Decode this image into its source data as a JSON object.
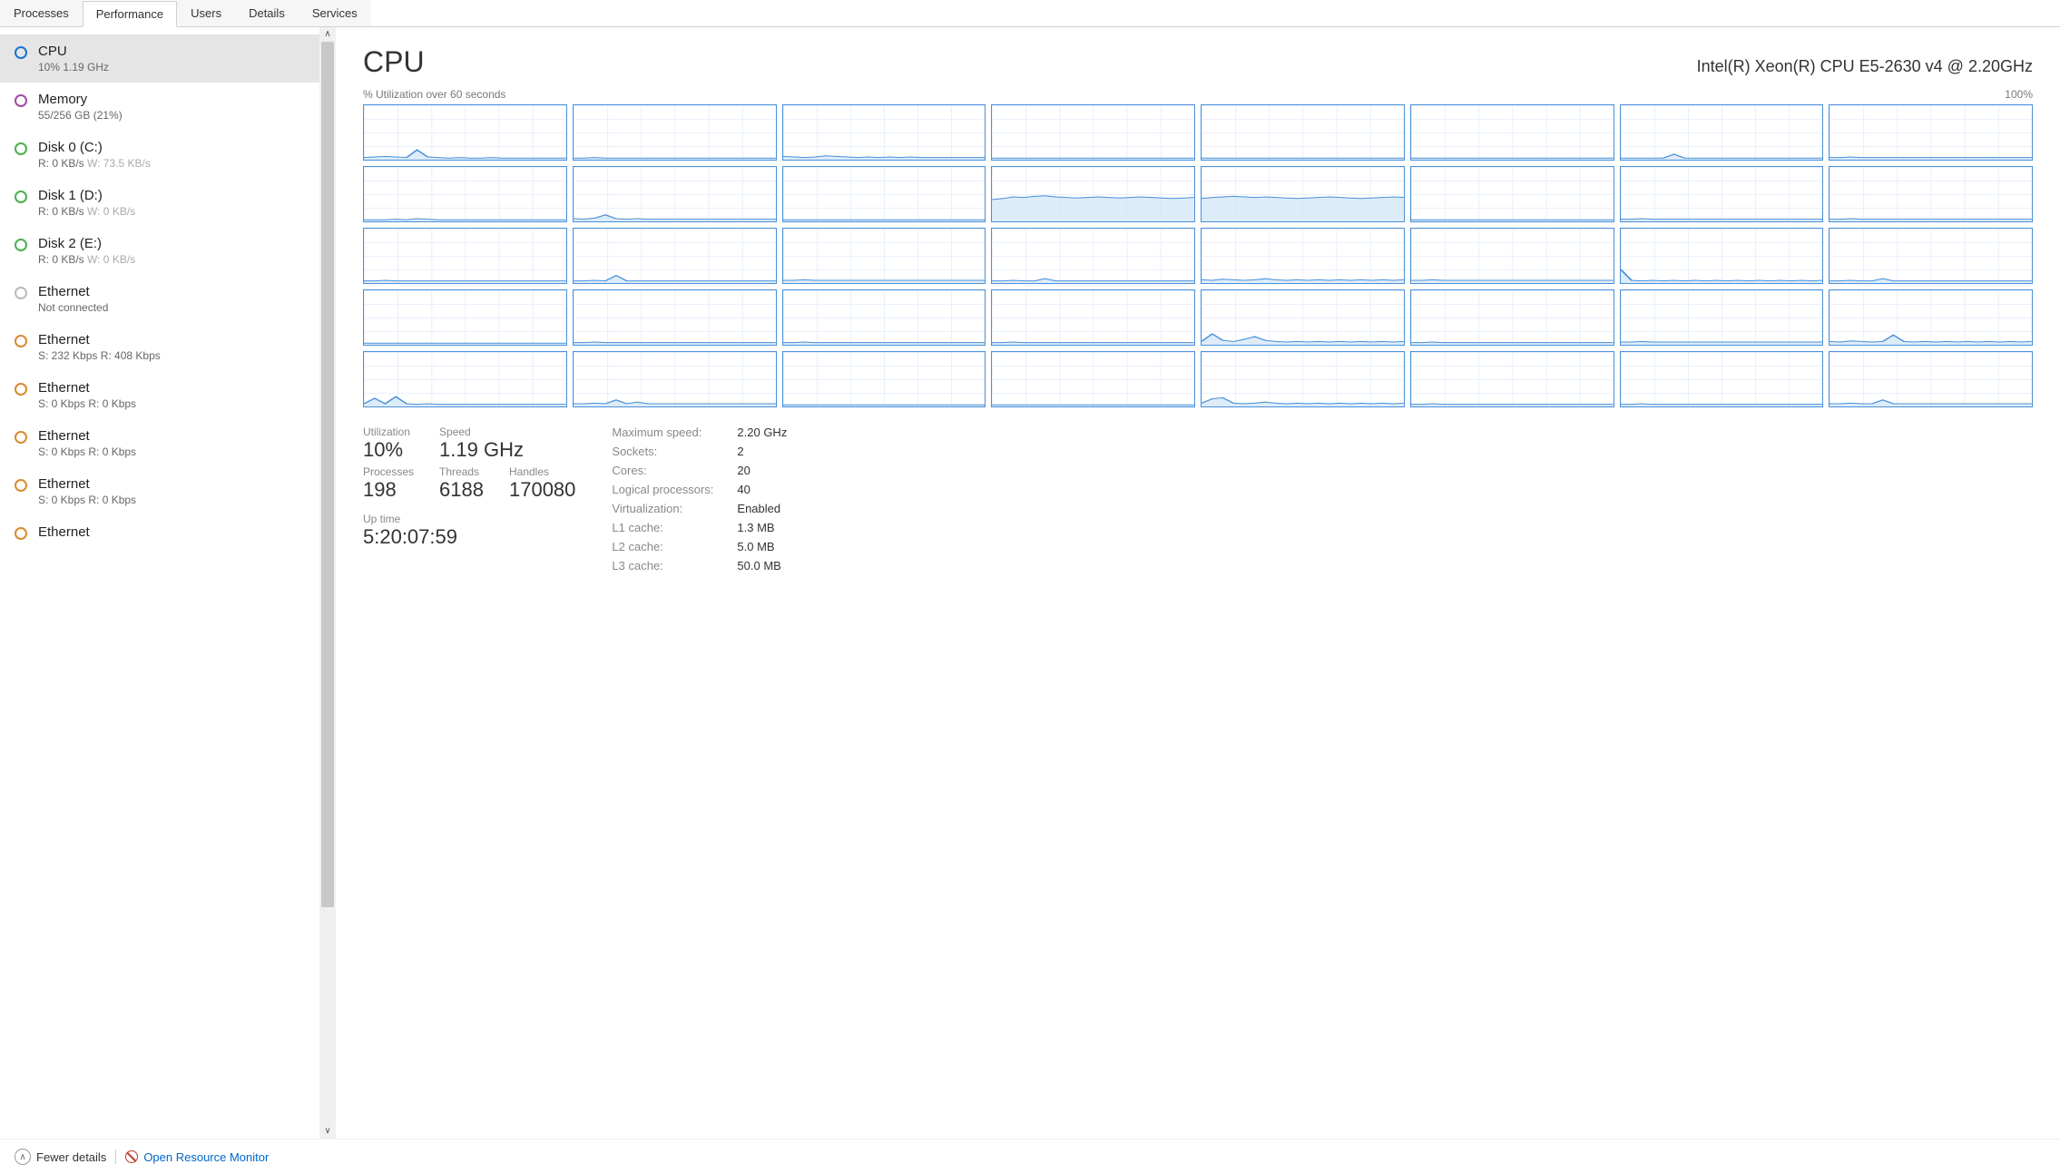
{
  "tabs": [
    "Processes",
    "Performance",
    "Users",
    "Details",
    "Services"
  ],
  "active_tab": 1,
  "sidebar": [
    {
      "title": "CPU",
      "sub": "10% 1.19 GHz",
      "color": "blue",
      "selected": true
    },
    {
      "title": "Memory",
      "sub": "55/256 GB (21%)",
      "color": "purple"
    },
    {
      "title": "Disk 0 (C:)",
      "sub": "R: 0 KB/s <span class='dim'>W: 73.5 KB/s</span>",
      "color": "green"
    },
    {
      "title": "Disk 1 (D:)",
      "sub": "R: 0 KB/s <span class='dim'>W: 0 KB/s</span>",
      "color": "green"
    },
    {
      "title": "Disk 2 (E:)",
      "sub": "R: 0 KB/s <span class='dim'>W: 0 KB/s</span>",
      "color": "green"
    },
    {
      "title": "Ethernet",
      "sub": "Not connected",
      "color": "gray"
    },
    {
      "title": "Ethernet",
      "sub": "S: 232 Kbps R: 408 Kbps",
      "color": "orange"
    },
    {
      "title": "Ethernet",
      "sub": "S: 0 Kbps R: 0 Kbps",
      "color": "orange"
    },
    {
      "title": "Ethernet",
      "sub": "S: 0 Kbps R: 0 Kbps",
      "color": "orange"
    },
    {
      "title": "Ethernet",
      "sub": "S: 0 Kbps R: 0 Kbps",
      "color": "orange"
    },
    {
      "title": "Ethernet",
      "sub": "",
      "color": "orange"
    }
  ],
  "header": {
    "title": "CPU",
    "subtitle": "Intel(R) Xeon(R) CPU E5-2630 v4 @ 2.20GHz"
  },
  "graph_label_left": "% Utilization over 60 seconds",
  "graph_label_right": "100%",
  "big_stats": {
    "utilization_label": "Utilization",
    "utilization": "10%",
    "speed_label": "Speed",
    "speed": "1.19 GHz",
    "processes_label": "Processes",
    "processes": "198",
    "threads_label": "Threads",
    "threads": "6188",
    "handles_label": "Handles",
    "handles": "170080",
    "uptime_label": "Up time",
    "uptime": "5:20:07:59"
  },
  "specs": [
    {
      "label": "Maximum speed:",
      "value": "2.20 GHz"
    },
    {
      "label": "Sockets:",
      "value": "2"
    },
    {
      "label": "Cores:",
      "value": "20"
    },
    {
      "label": "Logical processors:",
      "value": "40"
    },
    {
      "label": "Virtualization:",
      "value": "Enabled"
    },
    {
      "label": "L1 cache:",
      "value": "1.3 MB"
    },
    {
      "label": "L2 cache:",
      "value": "5.0 MB"
    },
    {
      "label": "L3 cache:",
      "value": "50.0 MB"
    }
  ],
  "footer": {
    "fewer": "Fewer details",
    "monitor": "Open Resource Monitor"
  },
  "chart_data": {
    "type": "area",
    "title": "% Utilization over 60 seconds",
    "xlabel": "seconds",
    "ylabel": "% utilization",
    "xlim": [
      0,
      60
    ],
    "ylim": [
      0,
      100
    ],
    "note": "40 small-multiple sparklines (one per logical processor). Values are approximate utilization samples read from the grid; most cores idle near 3–10%, a few (row2 col4–5) sustained ~45%, occasional spikes to 15–25%.",
    "series": [
      {
        "core": 0,
        "values": [
          4,
          5,
          6,
          5,
          4,
          18,
          5,
          4,
          3,
          4,
          3,
          3,
          4,
          3,
          3,
          3,
          3,
          3,
          3,
          3
        ]
      },
      {
        "core": 1,
        "values": [
          3,
          3,
          4,
          3,
          3,
          3,
          3,
          3,
          3,
          3,
          3,
          3,
          3,
          3,
          3,
          3,
          3,
          3,
          3,
          3
        ]
      },
      {
        "core": 2,
        "values": [
          6,
          5,
          4,
          5,
          7,
          6,
          5,
          4,
          5,
          4,
          5,
          4,
          5,
          4,
          4,
          4,
          4,
          4,
          4,
          4
        ]
      },
      {
        "core": 3,
        "values": [
          3,
          3,
          3,
          3,
          3,
          3,
          3,
          3,
          3,
          3,
          3,
          3,
          3,
          3,
          3,
          3,
          3,
          3,
          3,
          3
        ]
      },
      {
        "core": 4,
        "values": [
          3,
          3,
          3,
          3,
          3,
          3,
          3,
          3,
          3,
          3,
          3,
          3,
          3,
          3,
          3,
          3,
          3,
          3,
          3,
          3
        ]
      },
      {
        "core": 5,
        "values": [
          3,
          3,
          3,
          3,
          3,
          3,
          3,
          3,
          3,
          3,
          3,
          3,
          3,
          3,
          3,
          3,
          3,
          3,
          3,
          3
        ]
      },
      {
        "core": 6,
        "values": [
          3,
          3,
          3,
          3,
          3,
          10,
          3,
          3,
          3,
          3,
          3,
          3,
          3,
          3,
          3,
          3,
          3,
          3,
          3,
          3
        ]
      },
      {
        "core": 7,
        "values": [
          4,
          4,
          5,
          4,
          4,
          4,
          4,
          4,
          4,
          4,
          4,
          4,
          4,
          4,
          4,
          4,
          4,
          4,
          4,
          4
        ]
      },
      {
        "core": 8,
        "values": [
          3,
          3,
          3,
          4,
          3,
          5,
          4,
          3,
          3,
          3,
          3,
          3,
          3,
          3,
          3,
          3,
          3,
          3,
          3,
          3
        ]
      },
      {
        "core": 9,
        "values": [
          5,
          4,
          6,
          12,
          5,
          4,
          5,
          4,
          4,
          4,
          4,
          4,
          4,
          4,
          4,
          4,
          4,
          4,
          4,
          4
        ]
      },
      {
        "core": 10,
        "values": [
          3,
          3,
          3,
          3,
          3,
          3,
          3,
          3,
          3,
          3,
          3,
          3,
          3,
          3,
          3,
          3,
          3,
          3,
          3,
          3
        ]
      },
      {
        "core": 11,
        "values": [
          40,
          42,
          45,
          44,
          46,
          47,
          45,
          44,
          43,
          44,
          45,
          44,
          43,
          44,
          45,
          44,
          43,
          42,
          43,
          44
        ]
      },
      {
        "core": 12,
        "values": [
          42,
          44,
          45,
          46,
          45,
          44,
          45,
          44,
          43,
          42,
          43,
          44,
          45,
          44,
          43,
          42,
          43,
          44,
          45,
          44
        ]
      },
      {
        "core": 13,
        "values": [
          3,
          3,
          3,
          3,
          3,
          3,
          3,
          3,
          3,
          3,
          3,
          3,
          3,
          3,
          3,
          3,
          3,
          3,
          3,
          3
        ]
      },
      {
        "core": 14,
        "values": [
          4,
          4,
          5,
          4,
          4,
          4,
          4,
          4,
          4,
          4,
          4,
          4,
          4,
          4,
          4,
          4,
          4,
          4,
          4,
          4
        ]
      },
      {
        "core": 15,
        "values": [
          4,
          4,
          5,
          4,
          4,
          4,
          4,
          4,
          4,
          4,
          4,
          4,
          4,
          4,
          4,
          4,
          4,
          4,
          4,
          4
        ]
      },
      {
        "core": 16,
        "values": [
          4,
          4,
          5,
          4,
          4,
          4,
          4,
          4,
          4,
          4,
          4,
          4,
          4,
          4,
          4,
          4,
          4,
          4,
          4,
          4
        ]
      },
      {
        "core": 17,
        "values": [
          4,
          4,
          5,
          4,
          14,
          4,
          4,
          4,
          4,
          4,
          4,
          4,
          4,
          4,
          4,
          4,
          4,
          4,
          4,
          4
        ]
      },
      {
        "core": 18,
        "values": [
          5,
          5,
          6,
          5,
          5,
          5,
          5,
          5,
          5,
          5,
          5,
          5,
          5,
          5,
          5,
          5,
          5,
          5,
          5,
          5
        ]
      },
      {
        "core": 19,
        "values": [
          4,
          4,
          5,
          4,
          4,
          8,
          4,
          4,
          4,
          4,
          4,
          4,
          4,
          4,
          4,
          4,
          4,
          4,
          4,
          4
        ]
      },
      {
        "core": 20,
        "values": [
          6,
          5,
          7,
          6,
          5,
          6,
          8,
          6,
          5,
          6,
          5,
          6,
          5,
          6,
          5,
          6,
          5,
          6,
          5,
          6
        ]
      },
      {
        "core": 21,
        "values": [
          5,
          5,
          6,
          5,
          5,
          5,
          5,
          5,
          5,
          5,
          5,
          5,
          5,
          5,
          5,
          5,
          5,
          5,
          5,
          5
        ]
      },
      {
        "core": 22,
        "values": [
          25,
          5,
          4,
          5,
          4,
          5,
          4,
          5,
          4,
          5,
          4,
          5,
          4,
          5,
          4,
          5,
          4,
          5,
          4,
          5
        ]
      },
      {
        "core": 23,
        "values": [
          4,
          4,
          5,
          4,
          4,
          8,
          4,
          4,
          4,
          4,
          4,
          4,
          4,
          4,
          4,
          4,
          4,
          4,
          4,
          4
        ]
      },
      {
        "core": 24,
        "values": [
          3,
          3,
          3,
          3,
          3,
          3,
          3,
          3,
          3,
          3,
          3,
          3,
          3,
          3,
          3,
          3,
          3,
          3,
          3,
          3
        ]
      },
      {
        "core": 25,
        "values": [
          4,
          4,
          5,
          4,
          4,
          4,
          4,
          4,
          4,
          4,
          4,
          4,
          4,
          4,
          4,
          4,
          4,
          4,
          4,
          4
        ]
      },
      {
        "core": 26,
        "values": [
          4,
          4,
          5,
          4,
          4,
          4,
          4,
          4,
          4,
          4,
          4,
          4,
          4,
          4,
          4,
          4,
          4,
          4,
          4,
          4
        ]
      },
      {
        "core": 27,
        "values": [
          4,
          4,
          5,
          4,
          4,
          4,
          4,
          4,
          4,
          4,
          4,
          4,
          4,
          4,
          4,
          4,
          4,
          4,
          4,
          4
        ]
      },
      {
        "core": 28,
        "values": [
          6,
          20,
          8,
          6,
          10,
          15,
          8,
          6,
          5,
          6,
          5,
          6,
          5,
          6,
          5,
          6,
          5,
          6,
          5,
          6
        ]
      },
      {
        "core": 29,
        "values": [
          4,
          4,
          5,
          4,
          4,
          4,
          4,
          4,
          4,
          4,
          4,
          4,
          4,
          4,
          4,
          4,
          4,
          4,
          4,
          4
        ]
      },
      {
        "core": 30,
        "values": [
          5,
          5,
          6,
          5,
          5,
          5,
          5,
          5,
          5,
          5,
          5,
          5,
          5,
          5,
          5,
          5,
          5,
          5,
          5,
          5
        ]
      },
      {
        "core": 31,
        "values": [
          6,
          5,
          7,
          6,
          5,
          6,
          18,
          6,
          5,
          6,
          5,
          6,
          5,
          6,
          5,
          6,
          5,
          6,
          5,
          6
        ]
      },
      {
        "core": 32,
        "values": [
          5,
          15,
          5,
          18,
          5,
          4,
          5,
          4,
          4,
          4,
          4,
          4,
          4,
          4,
          4,
          4,
          4,
          4,
          4,
          4
        ]
      },
      {
        "core": 33,
        "values": [
          5,
          5,
          6,
          5,
          12,
          5,
          8,
          5,
          5,
          5,
          5,
          5,
          5,
          5,
          5,
          5,
          5,
          5,
          5,
          5
        ]
      },
      {
        "core": 34,
        "values": [
          3,
          3,
          3,
          3,
          3,
          3,
          3,
          3,
          3,
          3,
          3,
          3,
          3,
          3,
          3,
          3,
          3,
          3,
          3,
          3
        ]
      },
      {
        "core": 35,
        "values": [
          3,
          3,
          3,
          3,
          3,
          3,
          3,
          3,
          3,
          3,
          3,
          3,
          3,
          3,
          3,
          3,
          3,
          3,
          3,
          3
        ]
      },
      {
        "core": 36,
        "values": [
          6,
          14,
          16,
          6,
          5,
          6,
          8,
          6,
          5,
          6,
          5,
          6,
          5,
          6,
          5,
          6,
          5,
          6,
          5,
          6
        ]
      },
      {
        "core": 37,
        "values": [
          4,
          4,
          5,
          4,
          4,
          4,
          4,
          4,
          4,
          4,
          4,
          4,
          4,
          4,
          4,
          4,
          4,
          4,
          4,
          4
        ]
      },
      {
        "core": 38,
        "values": [
          4,
          4,
          5,
          4,
          4,
          4,
          4,
          4,
          4,
          4,
          4,
          4,
          4,
          4,
          4,
          4,
          4,
          4,
          4,
          4
        ]
      },
      {
        "core": 39,
        "values": [
          5,
          5,
          6,
          5,
          5,
          12,
          5,
          5,
          5,
          5,
          5,
          5,
          5,
          5,
          5,
          5,
          5,
          5,
          5,
          5
        ]
      }
    ]
  }
}
